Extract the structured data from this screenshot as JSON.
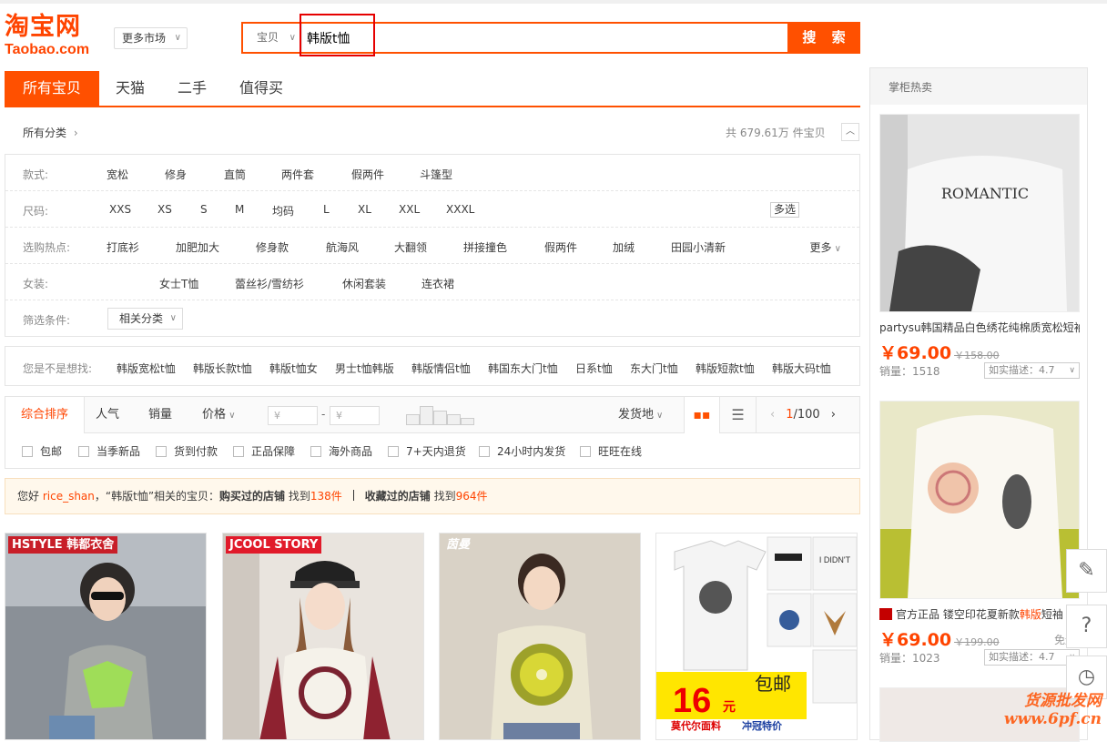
{
  "logo": {
    "cn": "淘宝网",
    "en": "Taobao.com"
  },
  "market_dropdown": {
    "label": "更多市场"
  },
  "search": {
    "type": "宝贝",
    "query": "韩版t恤",
    "button": "搜 索"
  },
  "tabs": [
    "所有宝贝",
    "天猫",
    "二手",
    "值得买"
  ],
  "crumb": "所有分类",
  "total": "共 679.61万 件宝贝",
  "filters": {
    "style": {
      "label": "款式:",
      "options": [
        "宽松",
        "修身",
        "直筒",
        "两件套",
        "假两件",
        "斗篷型"
      ]
    },
    "size": {
      "label": "尺码:",
      "options": [
        "XXS",
        "XS",
        "S",
        "M",
        "均码",
        "L",
        "XL",
        "XXL",
        "XXXL"
      ],
      "multi": "多选"
    },
    "hot": {
      "label": "选购热点:",
      "options": [
        "打底衫",
        "加肥加大",
        "修身款",
        "航海风",
        "大翻领",
        "拼接撞色",
        "假两件",
        "加绒",
        "田园小清新"
      ],
      "more": "更多"
    },
    "women": {
      "label": "女装:",
      "options": [
        "女士T恤",
        "蕾丝衫/雪纺衫",
        "休闲套装",
        "连衣裙"
      ]
    },
    "cond": {
      "label": "筛选条件:",
      "dropdown": "相关分类"
    }
  },
  "suggest": {
    "label": "您是不是想找:",
    "items": [
      "韩版宽松t恤",
      "韩版长款t恤",
      "韩版t恤女",
      "男士t恤韩版",
      "韩版情侣t恤",
      "韩国东大门t恤",
      "日系t恤",
      "东大门t恤",
      "韩版短款t恤",
      "韩版大码t恤"
    ]
  },
  "sort": {
    "items": [
      "综合排序",
      "人气",
      "销量",
      "价格"
    ],
    "price_ph": "¥",
    "ship": "发货地",
    "page_cur": "1",
    "page_total": "/100"
  },
  "checks": [
    "包邮",
    "当季新品",
    "货到付款",
    "正品保障",
    "海外商品",
    "7+天内退货",
    "24小时内发货",
    "旺旺在线"
  ],
  "notice": {
    "hello": "您好 ",
    "user": "rice_shan",
    "mid": "，“韩版t恤”相关的宝贝：",
    "bought": "购买过的店铺",
    "found1": " 找到",
    "n1": "138件",
    "fav": "收藏过的店铺",
    "found2": " 找到",
    "n2": "964件"
  },
  "products": [
    {
      "brand": "HSTYLE 韩都衣舍"
    },
    {
      "brand": "JCOOL STORY"
    },
    {
      "brand": "茵曼"
    },
    {
      "promo_price": "16",
      "promo_unit": "元",
      "promo_tag": "包邮",
      "promo_shop": "莫代尔面料",
      "promo_deal": "冲冠特价",
      "print_text": "I DIDN'T"
    }
  ],
  "sidebar": {
    "title": "掌柜热卖",
    "items": [
      {
        "title": "partysu韩国精品白色绣花纯棉质宽松短袖",
        "price": "￥69.00",
        "old": "￥158.00",
        "sales": "销量：1518",
        "rate": "如实描述：4.7",
        "shirt_text": "ROMANTIC"
      },
      {
        "title_pre": "官方正品 镂空印花夏新款",
        "title_hl": "韩版",
        "title_post": "短袖",
        "price": "￥69.00",
        "old": "￥199.00",
        "free": "免运",
        "sales": "销量：1023",
        "rate": "如实描述：4.7"
      }
    ]
  },
  "watermark": {
    "line1": "货源批发网",
    "line2": "www.6pf.cn"
  },
  "colors": {
    "accent": "#ff5000",
    "price": "#ff4400"
  }
}
